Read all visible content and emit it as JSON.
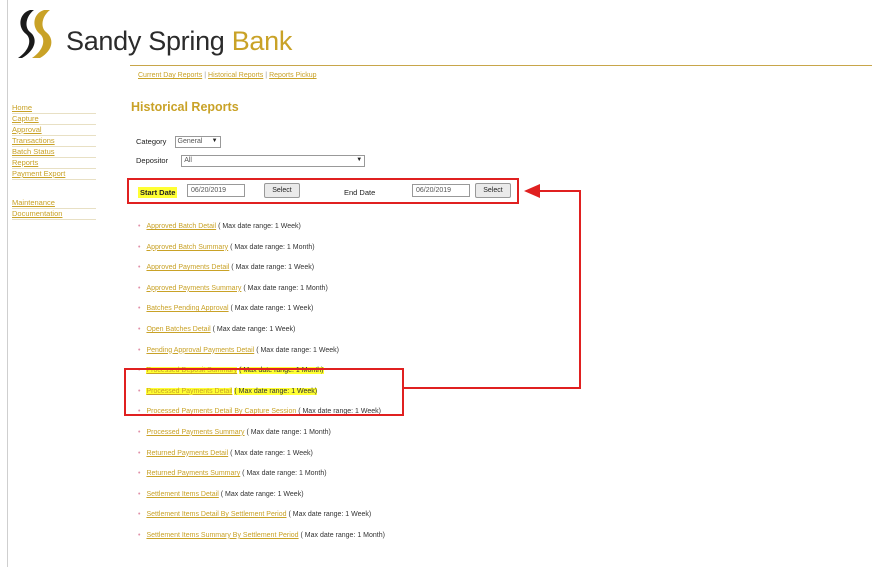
{
  "header": {
    "brand_main": "Sandy Spring ",
    "brand_accent": "Bank"
  },
  "top_links": [
    "Current Day Reports",
    "Historical Reports",
    "Reports Pickup"
  ],
  "sidebar": {
    "items": [
      "Home",
      "Capture",
      "Approval",
      "Transactions",
      "Batch Status",
      "Reports",
      "Payment Export"
    ],
    "items2": [
      "Maintenance",
      "Documentation"
    ]
  },
  "page_title": "Historical Reports",
  "form": {
    "category_label": "Category",
    "category_value": "General",
    "depositor_label": "Depositor",
    "depositor_value": "All",
    "start_label": "Start Date",
    "start_value": "06/20/2019",
    "end_label": "End Date",
    "end_value": "06/20/2019",
    "select_label": "Select"
  },
  "reports": [
    {
      "name": "Approved Batch Detail",
      "range": "( Max date range: 1 Week)",
      "highlight": false
    },
    {
      "name": "Approved Batch Summary",
      "range": "( Max date range: 1 Month)",
      "highlight": false
    },
    {
      "name": "Approved Payments Detail",
      "range": "( Max date range: 1 Week)",
      "highlight": false
    },
    {
      "name": "Approved Payments Summary",
      "range": "( Max date range: 1 Month)",
      "highlight": false
    },
    {
      "name": "Batches Pending Approval",
      "range": "( Max date range: 1 Week)",
      "highlight": false
    },
    {
      "name": "Open Batches Detail",
      "range": "( Max date range: 1 Week)",
      "highlight": false
    },
    {
      "name": "Pending Approval Payments Detail",
      "range": "( Max date range: 1 Week)",
      "highlight": false
    },
    {
      "name": "Processed Deposit Summary",
      "range": "( Max date range: 1 Month)",
      "highlight": true
    },
    {
      "name": "Processed Payments Detail",
      "range": "( Max date range: 1 Week)",
      "highlight": true
    },
    {
      "name": "Processed Payments Detail By Capture Session",
      "range": "( Max date range: 1 Week)",
      "highlight": false
    },
    {
      "name": "Processed Payments Summary",
      "range": "( Max date range: 1 Month)",
      "highlight": false
    },
    {
      "name": "Returned Payments Detail",
      "range": "( Max date range: 1 Week)",
      "highlight": false
    },
    {
      "name": "Returned Payments Summary",
      "range": "( Max date range: 1 Month)",
      "highlight": false
    },
    {
      "name": "Settlement Items Detail",
      "range": "( Max date range: 1 Week)",
      "highlight": false
    },
    {
      "name": "Settlement Items Detail By Settlement Period",
      "range": "( Max date range: 1 Week)",
      "highlight": false
    },
    {
      "name": "Settlement Items Summary By Settlement Period",
      "range": "( Max date range: 1 Month)",
      "highlight": false
    }
  ],
  "colors": {
    "accent": "#c9a227",
    "annotation": "#e02020",
    "highlight": "#ffff33"
  }
}
